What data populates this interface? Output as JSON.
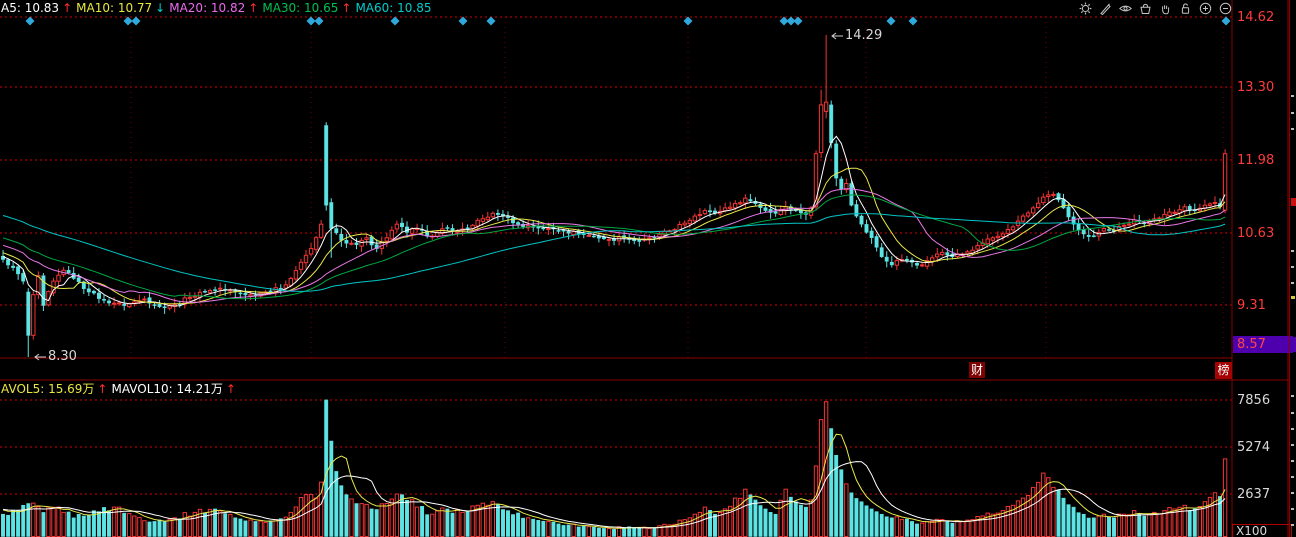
{
  "header": {
    "indicators": [
      {
        "label": "A5:",
        "value": "10.83",
        "color": "#ffffff",
        "arrow": "↑",
        "arrow_color": "#ff3030"
      },
      {
        "label": "MA10:",
        "value": "10.77",
        "color": "#e8e840",
        "arrow": "↓",
        "arrow_color": "#00d0d0"
      },
      {
        "label": "MA20:",
        "value": "10.82",
        "color": "#ee6bee",
        "arrow": "↑",
        "arrow_color": "#ff3030"
      },
      {
        "label": "MA30:",
        "value": "10.65",
        "color": "#00c050",
        "arrow": "↑",
        "arrow_color": "#ff3030"
      },
      {
        "label": "MA60:",
        "value": "10.85",
        "color": "#00cccc",
        "arrow": "",
        "arrow_color": ""
      }
    ]
  },
  "volume_header": {
    "indicators": [
      {
        "label": "AVOL5:",
        "value": "15.69万",
        "color": "#e8e840",
        "arrow": "↑",
        "arrow_color": "#ff3030"
      },
      {
        "label": "MAVOL10:",
        "value": "14.21万",
        "color": "#ffffff",
        "arrow": "↑",
        "arrow_color": "#ff3030"
      }
    ]
  },
  "toolbar": {
    "icons": [
      {
        "name": "settings"
      },
      {
        "name": "pencil"
      },
      {
        "name": "eye"
      },
      {
        "name": "basket"
      },
      {
        "name": "hand"
      },
      {
        "name": "lock"
      },
      {
        "name": "zoom-in"
      },
      {
        "name": "zoom-out"
      }
    ]
  },
  "price_axis": {
    "ticks": [
      "14.62",
      "13.30",
      "11.98",
      "10.63",
      "9.31"
    ],
    "current_badge": "8.57"
  },
  "volume_axis": {
    "ticks": [
      "7856",
      "5274",
      "2637"
    ],
    "unit": "X100"
  },
  "badges": {
    "left": "财",
    "right": "榜"
  },
  "annotations": {
    "high": "14.29",
    "low": "8.30"
  },
  "chart_data": {
    "type": "candlestick_with_volume",
    "candle_count": 243,
    "price_ticks": [
      14.62,
      13.3,
      11.98,
      10.63,
      9.31
    ],
    "volume_ticks": [
      7856,
      5274,
      2637
    ],
    "volume_unit": "X100",
    "high_annotation": {
      "index": 163,
      "price": 14.29
    },
    "low_annotation": {
      "index": 5,
      "price": 8.3
    },
    "current_price_badge": 8.57,
    "colors": {
      "up": "#f23535",
      "down": "#5ce4e4",
      "ma5": "#ffffff",
      "ma10": "#e8e84a",
      "ma20": "#e878e8",
      "ma30": "#00a843",
      "ma60": "#00c5c5",
      "grid": "#d40000",
      "marker": "#2fa9db"
    },
    "ma_periods": [
      5,
      10,
      20,
      30,
      60
    ],
    "mavol_periods": [
      5,
      10
    ],
    "marker_diamonds_x": [
      30,
      128,
      136,
      311,
      319,
      395,
      463,
      491,
      688,
      784,
      791,
      798,
      891,
      913,
      1226
    ],
    "vertical_gridlines_x": [
      131,
      311,
      505,
      688,
      866,
      1046,
      1223
    ],
    "close_anchors": [
      [
        0,
        10.15
      ],
      [
        2,
        10.0
      ],
      [
        4,
        9.75
      ],
      [
        5,
        8.75
      ],
      [
        6,
        9.5
      ],
      [
        7,
        9.85
      ],
      [
        8,
        9.3
      ],
      [
        10,
        9.75
      ],
      [
        12,
        9.95
      ],
      [
        14,
        9.8
      ],
      [
        17,
        9.55
      ],
      [
        20,
        9.4
      ],
      [
        24,
        9.3
      ],
      [
        28,
        9.42
      ],
      [
        31,
        9.28
      ],
      [
        34,
        9.32
      ],
      [
        37,
        9.45
      ],
      [
        40,
        9.55
      ],
      [
        43,
        9.62
      ],
      [
        46,
        9.55
      ],
      [
        49,
        9.5
      ],
      [
        52,
        9.55
      ],
      [
        55,
        9.62
      ],
      [
        57,
        9.8
      ],
      [
        59,
        10.1
      ],
      [
        61,
        10.35
      ],
      [
        63,
        10.8
      ],
      [
        64,
        11.15
      ],
      [
        65,
        10.72
      ],
      [
        67,
        10.5
      ],
      [
        70,
        10.42
      ],
      [
        72,
        10.55
      ],
      [
        74,
        10.35
      ],
      [
        76,
        10.55
      ],
      [
        78,
        10.8
      ],
      [
        80,
        10.65
      ],
      [
        82,
        10.72
      ],
      [
        84,
        10.58
      ],
      [
        86,
        10.65
      ],
      [
        88,
        10.72
      ],
      [
        90,
        10.68
      ],
      [
        93,
        10.78
      ],
      [
        95,
        10.9
      ],
      [
        97,
        11.0
      ],
      [
        99,
        10.95
      ],
      [
        102,
        10.8
      ],
      [
        105,
        10.75
      ],
      [
        108,
        10.72
      ],
      [
        111,
        10.68
      ],
      [
        114,
        10.62
      ],
      [
        117,
        10.58
      ],
      [
        120,
        10.52
      ],
      [
        123,
        10.55
      ],
      [
        126,
        10.48
      ],
      [
        129,
        10.55
      ],
      [
        132,
        10.68
      ],
      [
        135,
        10.82
      ],
      [
        137,
        10.95
      ],
      [
        139,
        11.05
      ],
      [
        141,
        11.0
      ],
      [
        143,
        11.1
      ],
      [
        145,
        11.18
      ],
      [
        147,
        11.28
      ],
      [
        149,
        11.18
      ],
      [
        151,
        11.05
      ],
      [
        153,
        11.0
      ],
      [
        155,
        11.12
      ],
      [
        157,
        11.05
      ],
      [
        159,
        10.98
      ],
      [
        160,
        11.1
      ],
      [
        161,
        12.1
      ],
      [
        162,
        13.0
      ],
      [
        163,
        13.05
      ],
      [
        164,
        12.3
      ],
      [
        165,
        11.65
      ],
      [
        166,
        11.45
      ],
      [
        167,
        11.55
      ],
      [
        168,
        11.15
      ],
      [
        169,
        10.95
      ],
      [
        170,
        10.8
      ],
      [
        171,
        10.65
      ],
      [
        172,
        10.55
      ],
      [
        174,
        10.2
      ],
      [
        176,
        10.05
      ],
      [
        178,
        10.15
      ],
      [
        180,
        10.1
      ],
      [
        182,
        10.05
      ],
      [
        184,
        10.18
      ],
      [
        186,
        10.28
      ],
      [
        188,
        10.2
      ],
      [
        190,
        10.25
      ],
      [
        192,
        10.32
      ],
      [
        194,
        10.45
      ],
      [
        196,
        10.55
      ],
      [
        198,
        10.62
      ],
      [
        200,
        10.75
      ],
      [
        202,
        10.95
      ],
      [
        204,
        11.1
      ],
      [
        206,
        11.3
      ],
      [
        208,
        11.35
      ],
      [
        210,
        11.1
      ],
      [
        212,
        10.8
      ],
      [
        214,
        10.62
      ],
      [
        216,
        10.58
      ],
      [
        218,
        10.72
      ],
      [
        220,
        10.68
      ],
      [
        222,
        10.78
      ],
      [
        224,
        10.88
      ],
      [
        226,
        10.82
      ],
      [
        228,
        10.9
      ],
      [
        230,
        10.98
      ],
      [
        232,
        11.02
      ],
      [
        234,
        11.12
      ],
      [
        236,
        11.06
      ],
      [
        238,
        11.15
      ],
      [
        240,
        11.2
      ],
      [
        241,
        11.12
      ],
      [
        242,
        12.1
      ]
    ],
    "special_candles": [
      {
        "i": 5,
        "o": 9.55,
        "c": 8.75,
        "h": 9.62,
        "l": 8.3
      },
      {
        "i": 8,
        "o": 9.85,
        "c": 9.3,
        "h": 9.9,
        "l": 9.2
      },
      {
        "i": 64,
        "o": 12.62,
        "c": 11.15,
        "h": 12.68,
        "l": 11.05
      },
      {
        "i": 65,
        "o": 11.2,
        "c": 10.72,
        "h": 11.28,
        "l": 10.18
      },
      {
        "i": 161,
        "o": 11.12,
        "c": 12.1,
        "h": 12.16,
        "l": 11.05
      },
      {
        "i": 162,
        "o": 12.12,
        "c": 13.0,
        "h": 13.28,
        "l": 12.02
      },
      {
        "i": 163,
        "o": 12.88,
        "c": 13.05,
        "h": 14.29,
        "l": 12.75
      },
      {
        "i": 164,
        "o": 13.0,
        "c": 12.3,
        "h": 13.08,
        "l": 12.2
      },
      {
        "i": 165,
        "o": 12.28,
        "c": 11.65,
        "h": 12.35,
        "l": 11.5
      },
      {
        "i": 242,
        "o": 11.06,
        "c": 12.1,
        "h": 12.18,
        "l": 11.0
      }
    ],
    "volume_anchors": [
      [
        0,
        1500
      ],
      [
        3,
        1700
      ],
      [
        5,
        2100
      ],
      [
        8,
        1600
      ],
      [
        11,
        1900
      ],
      [
        14,
        1300
      ],
      [
        18,
        1700
      ],
      [
        22,
        1900
      ],
      [
        26,
        1400
      ],
      [
        30,
        1100
      ],
      [
        34,
        1300
      ],
      [
        38,
        1600
      ],
      [
        42,
        1800
      ],
      [
        46,
        1300
      ],
      [
        50,
        1100
      ],
      [
        54,
        1200
      ],
      [
        57,
        1600
      ],
      [
        60,
        2600
      ],
      [
        62,
        2400
      ],
      [
        63,
        3300
      ],
      [
        64,
        7900
      ],
      [
        65,
        5600
      ],
      [
        66,
        3900
      ],
      [
        67,
        3100
      ],
      [
        68,
        2600
      ],
      [
        70,
        2100
      ],
      [
        73,
        1800
      ],
      [
        76,
        2100
      ],
      [
        79,
        2600
      ],
      [
        82,
        1900
      ],
      [
        85,
        1500
      ],
      [
        88,
        1800
      ],
      [
        91,
        1600
      ],
      [
        94,
        2000
      ],
      [
        97,
        2200
      ],
      [
        100,
        1700
      ],
      [
        104,
        1300
      ],
      [
        108,
        1100
      ],
      [
        112,
        900
      ],
      [
        116,
        800
      ],
      [
        120,
        700
      ],
      [
        124,
        800
      ],
      [
        128,
        700
      ],
      [
        132,
        900
      ],
      [
        135,
        1200
      ],
      [
        137,
        1500
      ],
      [
        139,
        1900
      ],
      [
        141,
        1500
      ],
      [
        143,
        1800
      ],
      [
        145,
        2400
      ],
      [
        147,
        2900
      ],
      [
        149,
        2300
      ],
      [
        151,
        1800
      ],
      [
        153,
        1500
      ],
      [
        155,
        2900
      ],
      [
        157,
        2200
      ],
      [
        159,
        1900
      ],
      [
        160,
        2300
      ],
      [
        161,
        4200
      ],
      [
        162,
        6800
      ],
      [
        163,
        7800
      ],
      [
        164,
        6300
      ],
      [
        165,
        4800
      ],
      [
        166,
        4000
      ],
      [
        167,
        3200
      ],
      [
        168,
        2700
      ],
      [
        170,
        2200
      ],
      [
        172,
        1800
      ],
      [
        174,
        1500
      ],
      [
        176,
        1300
      ],
      [
        178,
        1200
      ],
      [
        180,
        1100
      ],
      [
        182,
        1000
      ],
      [
        184,
        1100
      ],
      [
        186,
        1200
      ],
      [
        188,
        1000
      ],
      [
        190,
        1100
      ],
      [
        192,
        1200
      ],
      [
        194,
        1400
      ],
      [
        196,
        1500
      ],
      [
        198,
        1700
      ],
      [
        200,
        2000
      ],
      [
        202,
        2400
      ],
      [
        204,
        3000
      ],
      [
        206,
        3800
      ],
      [
        208,
        3000
      ],
      [
        210,
        2400
      ],
      [
        212,
        1900
      ],
      [
        214,
        1500
      ],
      [
        216,
        1300
      ],
      [
        218,
        1500
      ],
      [
        220,
        1300
      ],
      [
        222,
        1500
      ],
      [
        224,
        1700
      ],
      [
        226,
        1400
      ],
      [
        228,
        1600
      ],
      [
        230,
        1700
      ],
      [
        232,
        1800
      ],
      [
        234,
        2000
      ],
      [
        236,
        1800
      ],
      [
        238,
        2200
      ],
      [
        240,
        2700
      ],
      [
        241,
        2500
      ],
      [
        242,
        4600
      ]
    ]
  }
}
